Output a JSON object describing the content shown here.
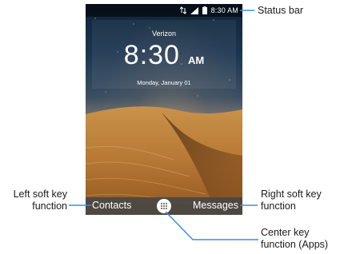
{
  "status_bar": {
    "time": "8:30 AM",
    "icons": [
      "signal-bars-icon",
      "battery-icon",
      "network-activity-icon"
    ]
  },
  "clock": {
    "carrier": "Verizon",
    "time": "8:30",
    "ampm": "AM",
    "date": "Monday, January 01"
  },
  "softkeys": {
    "left": "Contacts",
    "center_icon": "apps-grid-icon",
    "right": "Messages"
  },
  "callouts": {
    "status_bar": "Status bar",
    "left_soft_key_line1": "Left soft key",
    "left_soft_key_line2": "function",
    "right_soft_key_line1": "Right soft key",
    "right_soft_key_line2": "function",
    "center_key_line1": "Center key",
    "center_key_line2": "function (Apps)"
  },
  "colors": {
    "callout_line": "#3a8fd9",
    "softkey_bar": "#464646"
  }
}
